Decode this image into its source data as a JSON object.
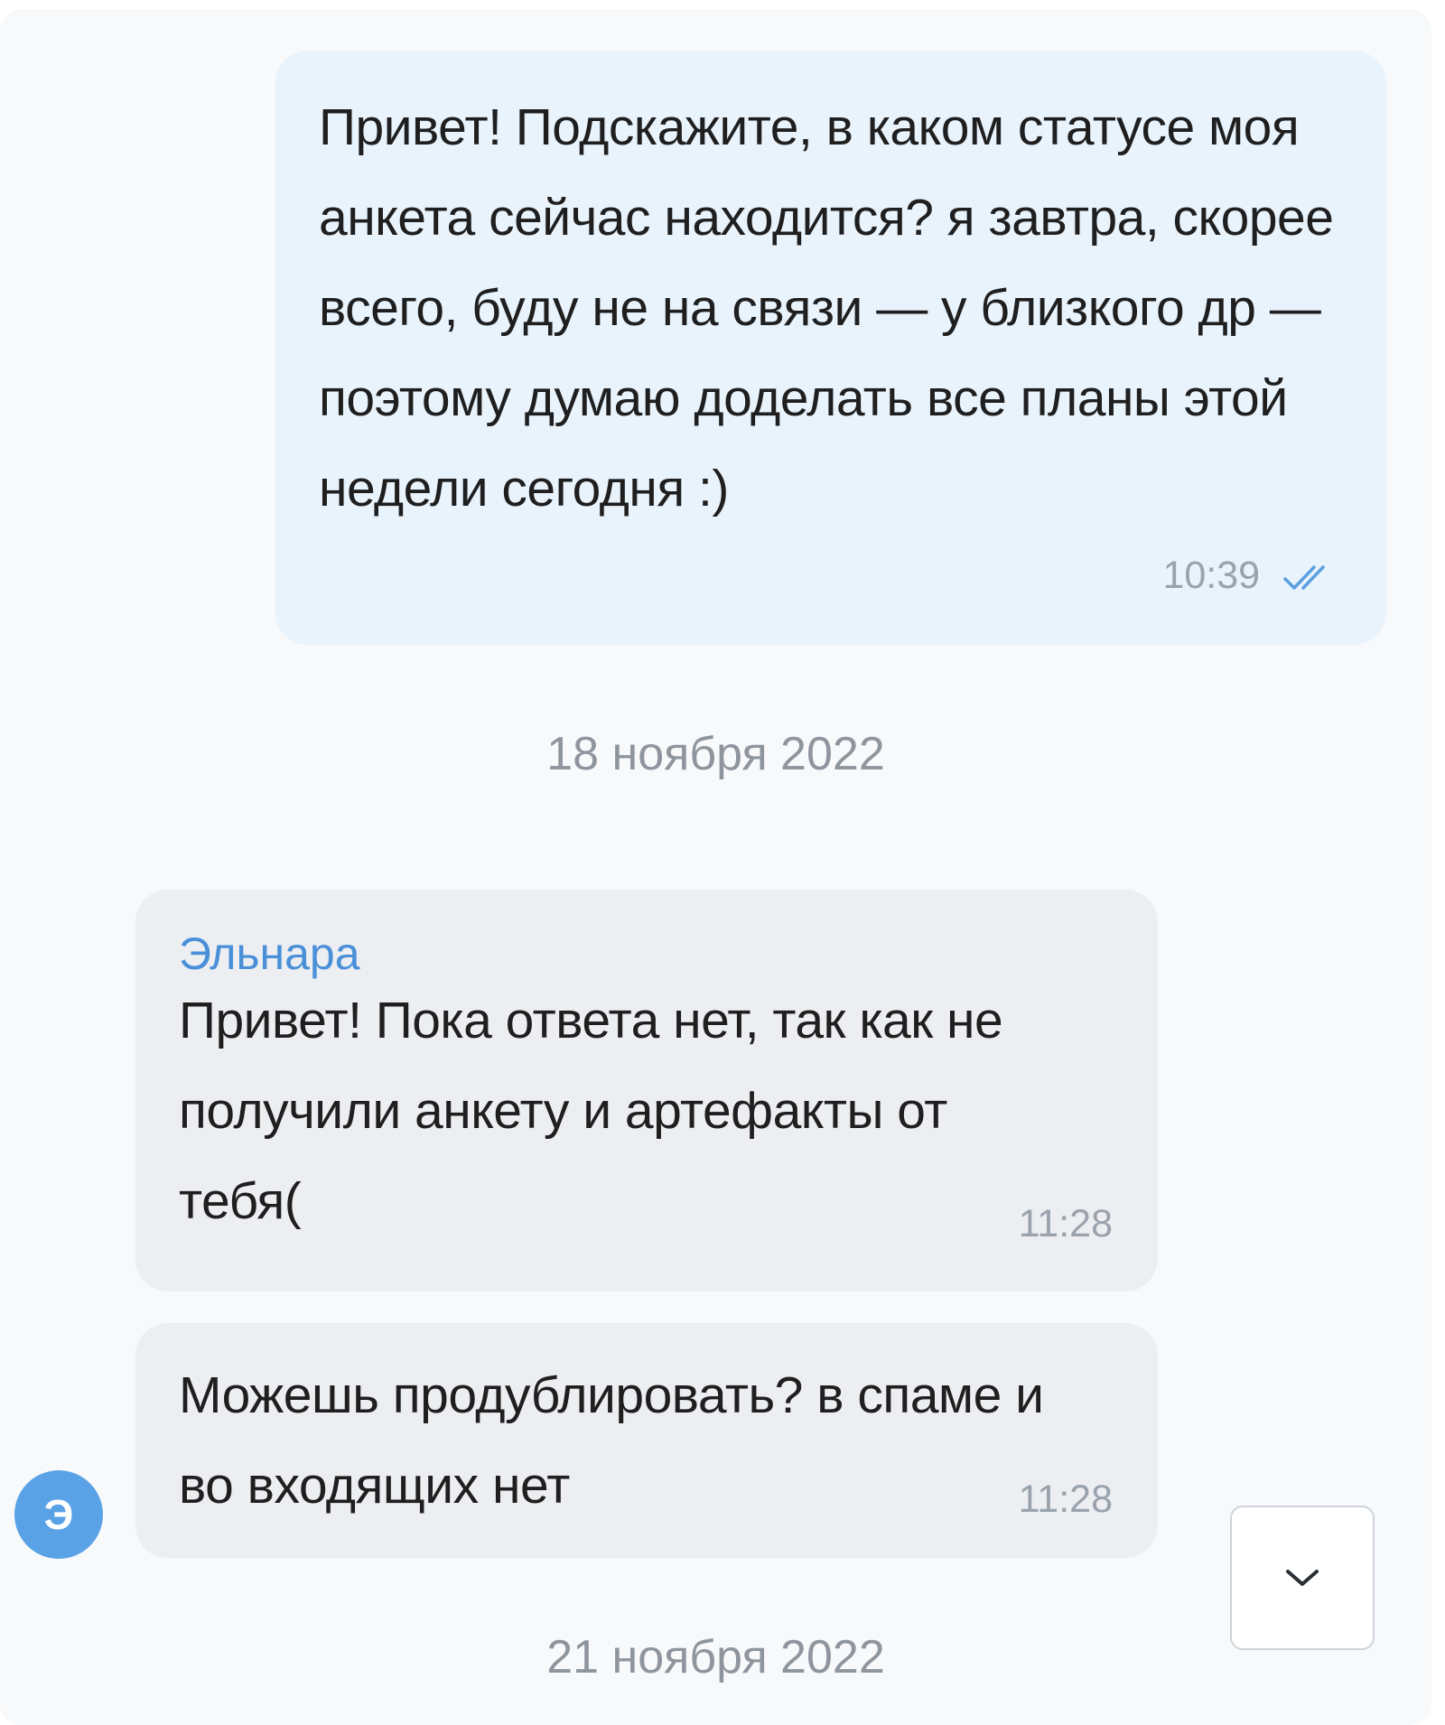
{
  "messages": {
    "outgoing": {
      "text": "Привет! Подскажите, в каком статусе моя анкета сейчас находится? я завтра, скорее всего, буду не на связи — у близкого др — поэтому думаю доделать все планы этой недели сегодня :)",
      "time": "10:39",
      "status_icon": "double-check-icon"
    },
    "incoming": [
      {
        "sender": "Эльнара",
        "text": "Привет! Пока ответа нет, так как не получили анкету и артефакты от тебя(",
        "time": "11:28"
      },
      {
        "text": "Можешь продублировать? в спаме и во входящих нет",
        "time": "11:28"
      }
    ]
  },
  "date_separators": [
    "18 ноября 2022",
    "21 ноября 2022"
  ],
  "avatar": {
    "initial": "Э",
    "color": "#5aa2e6"
  },
  "scroll_button": {
    "icon": "chevron-down-icon"
  },
  "colors": {
    "outgoing_bubble": "#e8f3fc",
    "incoming_bubble": "#eceef1",
    "sender_name": "#4a90d9",
    "meta_text": "#9aa3ad"
  }
}
